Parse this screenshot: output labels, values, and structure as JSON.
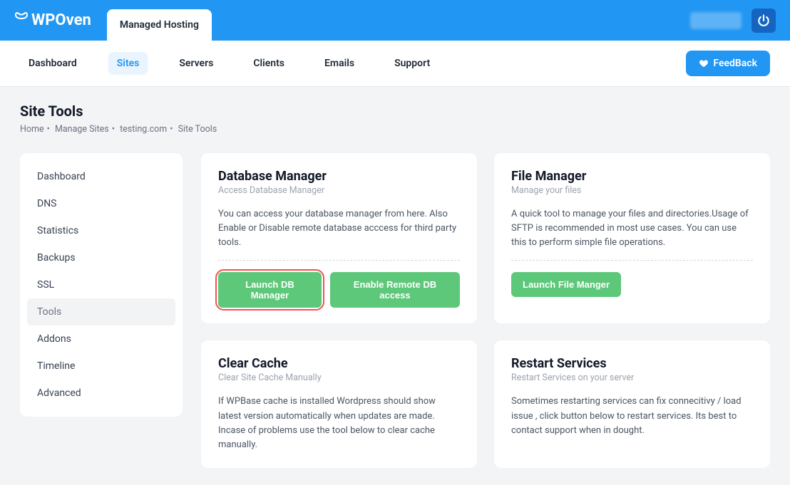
{
  "brand": "WPOven",
  "top_tab": "Managed Hosting",
  "nav": {
    "items": [
      "Dashboard",
      "Sites",
      "Servers",
      "Clients",
      "Emails",
      "Support"
    ],
    "active_index": 1,
    "feedback_label": "FeedBack"
  },
  "page": {
    "title": "Site Tools",
    "breadcrumbs": [
      "Home",
      "Manage Sites",
      "testing.com",
      "Site Tools"
    ]
  },
  "sidebar": {
    "items": [
      "Dashboard",
      "DNS",
      "Statistics",
      "Backups",
      "SSL",
      "Tools",
      "Addons",
      "Timeline",
      "Advanced"
    ],
    "active_index": 5
  },
  "cards": {
    "db": {
      "title": "Database Manager",
      "sub": "Access Database Manager",
      "desc": "You can access your database manager from here. Also Enable or Disable remote database acccess for third party tools.",
      "btn1": "Launch DB Manager",
      "btn2": "Enable Remote DB access"
    },
    "fm": {
      "title": "File Manager",
      "sub": "Manage your files",
      "desc": "A quick tool to manage your files and directories.Usage of SFTP is recommended in most use cases. You can use this to perform simple file operations.",
      "btn1": "Launch File Manger"
    },
    "cc": {
      "title": "Clear Cache",
      "sub": "Clear Site Cache Manually",
      "desc": "If WPBase cache is installed Wordpress should show latest version automatically when updates are made. Incase of problems use the tool below to clear cache manually."
    },
    "rs": {
      "title": "Restart Services",
      "sub": "Restart Services on your server",
      "desc": "Sometimes restarting services can fix connecitivy / load issue , click button below to restart services. Its best to contact support when in dought."
    }
  }
}
